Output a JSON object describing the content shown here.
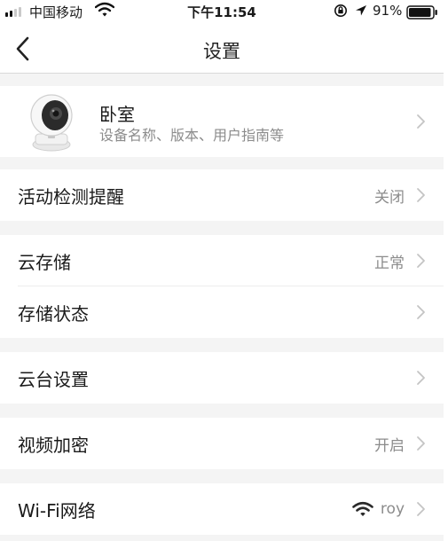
{
  "status_bar": {
    "carrier": "中国移动",
    "time": "下午11:54",
    "battery_percent": "91%",
    "icons": [
      "signal-icon",
      "wifi-icon",
      "orientation-lock-icon",
      "location-arrow-icon",
      "battery-icon"
    ]
  },
  "nav": {
    "title": "设置",
    "back_icon": "chevron-left-icon"
  },
  "device": {
    "name": "卧室",
    "subtitle": "设备名称、版本、用户指南等"
  },
  "settings": {
    "motion_alert": {
      "label": "活动检测提醒",
      "value": "关闭"
    },
    "cloud_storage": {
      "label": "云存储",
      "value": "正常"
    },
    "storage_status": {
      "label": "存储状态"
    },
    "ptz_settings": {
      "label": "云台设置"
    },
    "video_encryption": {
      "label": "视频加密",
      "value": "开启"
    },
    "wifi_network": {
      "label": "Wi-Fi网络",
      "value": "roy"
    }
  },
  "colors": {
    "background": "#f4f4f4",
    "row": "#ffffff",
    "text": "#1a1a1a",
    "secondary_text": "#8c8c8c",
    "chevron": "#c4c4c4"
  }
}
